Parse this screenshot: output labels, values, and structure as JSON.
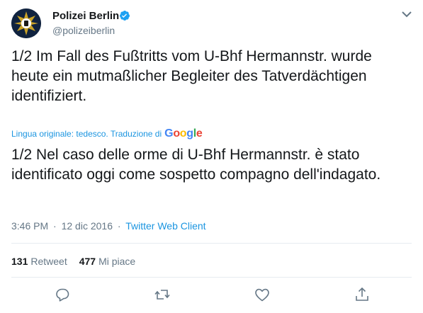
{
  "author": {
    "name": "Polizei Berlin",
    "handle": "@polizeiberlin",
    "avatar_icon": "police-badge-icon",
    "verified_icon": "verified-badge-icon"
  },
  "tweet": {
    "text": "1/2 Im Fall des Fußtritts vom U-Bhf Hermannstr. wurde heute ein mutmaßlicher Begleiter des Tatverdächtigen identifiziert.",
    "translation_label": "Lingua originale: tedesco. Traduzione di",
    "translation_provider": [
      "G",
      "o",
      "o",
      "g",
      "l",
      "e"
    ],
    "translated_text": "1/2 Nel caso delle orme di U-Bhf Hermannstr. è stato identificato oggi come sospetto compagno dell'indagato.",
    "time": "3:46 PM",
    "separator": "·",
    "date": "12 dic 2016",
    "client": "Twitter Web Client"
  },
  "stats": {
    "retweets_count": "131",
    "retweets_label": "Retweet",
    "likes_count": "477",
    "likes_label": "Mi piace"
  },
  "actions": [
    "reply-icon",
    "retweet-icon",
    "like-icon",
    "share-icon"
  ],
  "colors": {
    "link": "#1b95e0",
    "secondary": "#657786",
    "text": "#14171a",
    "divider": "#e6ecf0"
  }
}
